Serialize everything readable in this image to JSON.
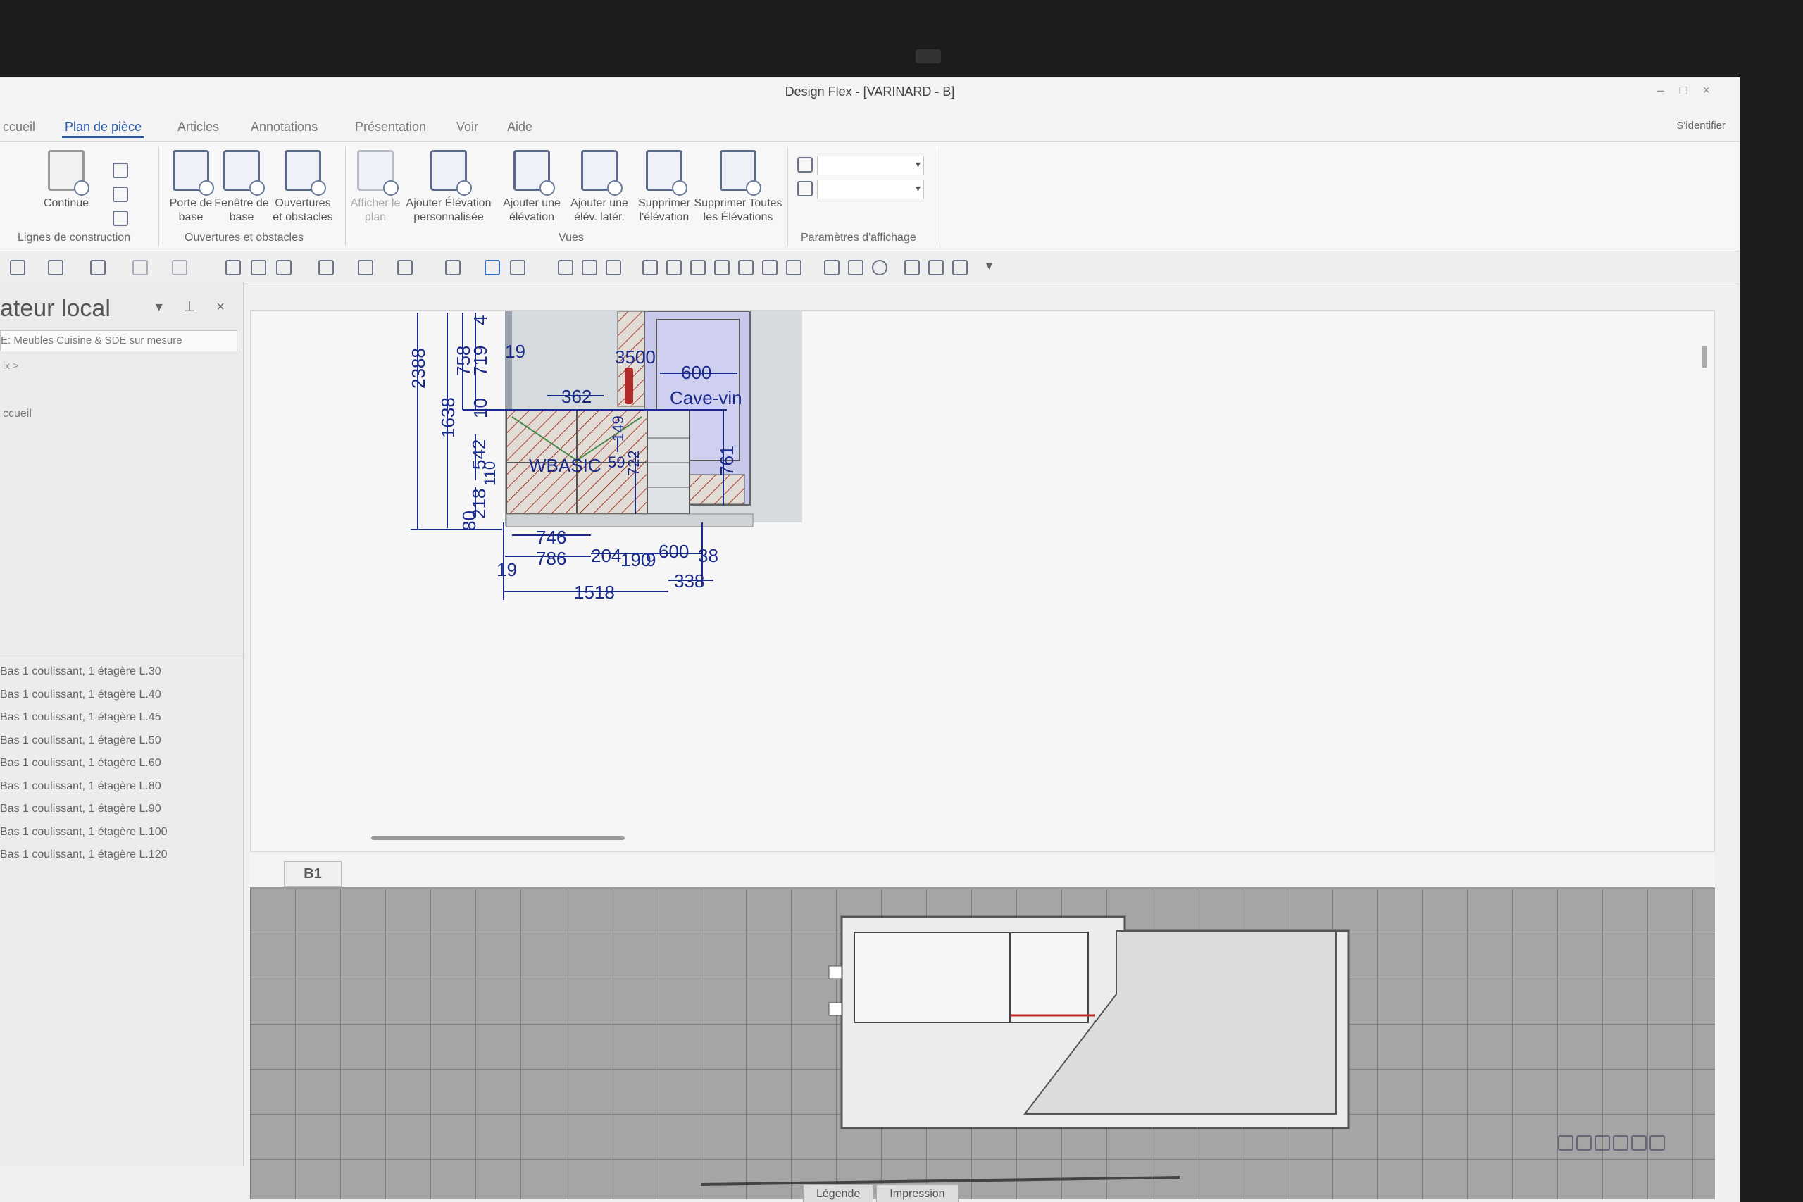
{
  "window": {
    "title": "Design Flex - [VARINARD - B]",
    "controls": [
      "–",
      "□",
      "×"
    ],
    "identity": "S'identifier"
  },
  "tabs": [
    {
      "label": "ccueil",
      "active": false
    },
    {
      "label": "Plan de pièce",
      "active": true
    },
    {
      "label": "Articles",
      "active": false
    },
    {
      "label": "Annotations",
      "active": false
    },
    {
      "label": "Présentation",
      "active": false
    },
    {
      "label": "Voir",
      "active": false
    },
    {
      "label": "Aide",
      "active": false
    }
  ],
  "ribbon": {
    "construction": {
      "continue_label": "Continue",
      "group_label": "Lignes de construction"
    },
    "openings": {
      "buttons": [
        "Porte de base",
        "Fenêtre de base",
        "Ouvertures et obstacles"
      ],
      "group_label": "Ouvertures et obstacles"
    },
    "views": {
      "buttons": [
        {
          "label": "Afficher le plan",
          "disabled": true
        },
        {
          "label": "Ajouter Élévation personnalisée",
          "disabled": false
        },
        {
          "label": "Ajouter une élévation",
          "disabled": false
        },
        {
          "label": "Ajouter une élév. latér.",
          "disabled": false
        },
        {
          "label": "Supprimer l'élévation",
          "disabled": false
        },
        {
          "label": "Supprimer Toutes les Élévations",
          "disabled": false
        }
      ],
      "group_label": "Vues"
    },
    "display": {
      "group_label": "Paramètres d'affichage",
      "combo1": "",
      "combo2": ""
    }
  },
  "sidebar": {
    "title": "ateur local",
    "selected_catalog": "E: Meubles Cuisine & SDE sur mesure",
    "breadcrumb": "ix >",
    "folder": "ccueil",
    "items": [
      "Bas 1 coulissant, 1 étagère L.30",
      "Bas 1 coulissant, 1 étagère L.40",
      "Bas 1 coulissant, 1 étagère L.45",
      "Bas 1 coulissant, 1 étagère L.50",
      "Bas 1 coulissant, 1 étagère L.60",
      "Bas 1 coulissant, 1 étagère L.80",
      "Bas 1 coulissant, 1 étagère L.90",
      "Bas 1 coulissant, 1 étagère L.100",
      "Bas 1 coulissant, 1 étagère L.120"
    ]
  },
  "elevation": {
    "sheet_tab": "B1",
    "cabinet_labels": {
      "sink": "WBASIC",
      "wine": "Cave-vin"
    },
    "dims": {
      "d2388": "2388",
      "d1638": "1638",
      "d758": "758",
      "d719": "719",
      "d4": "4",
      "d19a": "19",
      "d10": "10",
      "d542": "542",
      "d110": "110",
      "d218": "218",
      "d80": "80",
      "d362": "362",
      "d3500": "3500",
      "d600a": "600",
      "d149": "149",
      "d59": "59",
      "d722": "722",
      "d761": "761",
      "d746": "746",
      "d786": "786",
      "d19b": "19",
      "d204": "204",
      "d190": "190",
      "d9": "9",
      "d600b": "600",
      "d38": "38",
      "d1518": "1518",
      "d338": "338"
    },
    "colors": {
      "dim": "#1a2a8a",
      "wine_panel": "#c8c8ea",
      "hatch": "#a33a2a"
    }
  },
  "bottom_tabs": [
    "Légende",
    "Impression"
  ]
}
